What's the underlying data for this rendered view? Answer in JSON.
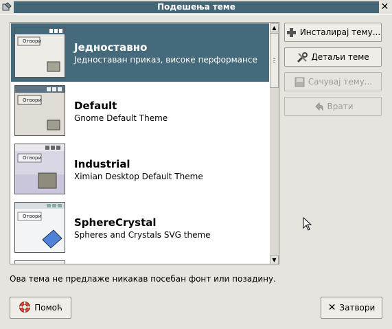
{
  "window": {
    "title": "Подешења теме"
  },
  "themes": [
    {
      "name": "Једноставно",
      "description": "Једноставан приказ, високе перформансе",
      "thumb_label": "Отвори",
      "selected": true
    },
    {
      "name": "Default",
      "description": "Gnome Default Theme",
      "thumb_label": "Отвори",
      "selected": false
    },
    {
      "name": "Industrial",
      "description": "Ximian Desktop Default Theme",
      "thumb_label": "Отвори",
      "selected": false
    },
    {
      "name": "SphereCrystal",
      "description": "Spheres and Crystals SVG theme",
      "thumb_label": "Отвори",
      "selected": false
    }
  ],
  "side_buttons": {
    "install": "Инсталирај тему...",
    "details": "Детаљи теме",
    "save": "Сачувај тему...",
    "revert": "Врати"
  },
  "info_text": "Ова тема не предлаже никакав посебан фонт или позадину.",
  "bottom": {
    "help": "Помоћ",
    "close": "Затвори"
  },
  "colors": {
    "title_band": "#446777",
    "selection": "#456a7b",
    "background": "#e6e4de"
  }
}
